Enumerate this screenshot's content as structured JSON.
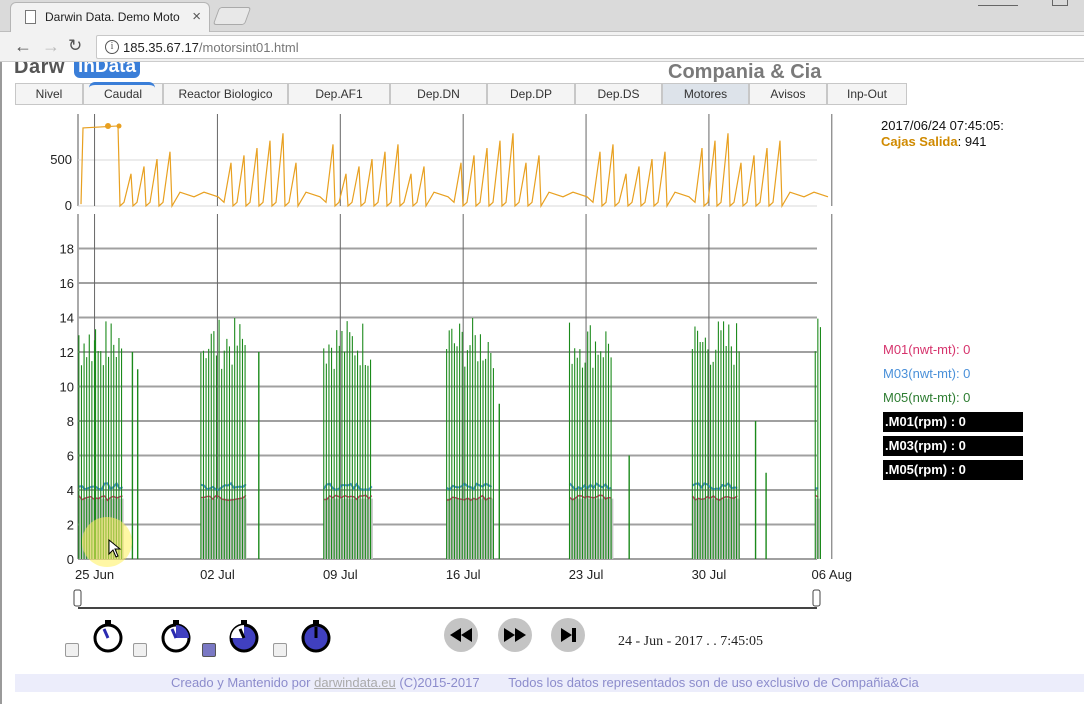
{
  "browser": {
    "tab_title": "Darwin Data. Demo Moto",
    "url_host": "185.35.67.17",
    "url_path": "/motorsint01.html"
  },
  "header": {
    "logo_left": "Darw",
    "logo_badge": "inData",
    "company": "Compania & Cia"
  },
  "menu": [
    {
      "label": "Nivel",
      "active": false
    },
    {
      "label": "Caudal",
      "active": false
    },
    {
      "label": "Reactor Biologico",
      "active": false
    },
    {
      "label": "Dep.AF1",
      "active": false
    },
    {
      "label": "Dep.DN",
      "active": false
    },
    {
      "label": "Dep.DP",
      "active": false
    },
    {
      "label": "Dep.DS",
      "active": false
    },
    {
      "label": "Motores",
      "active": true
    },
    {
      "label": "Avisos",
      "active": false
    },
    {
      "label": "Inp-Out",
      "active": false
    }
  ],
  "readout": {
    "timestamp": "2017/06/24 07:45:05:",
    "cajas_label": "Cajas Salida",
    "cajas_value": ": 941"
  },
  "legend": [
    {
      "text": "M01(nwt-mt): 0",
      "color": "#d6336c"
    },
    {
      "text": "M03(nwt-mt): 0",
      "color": "#4a90d9"
    },
    {
      "text": "M05(nwt-mt): 0",
      "color": "#2e7d32"
    }
  ],
  "legend_boxes": [
    ".M01(rpm) : 0",
    ".M03(rpm) : 0",
    ".M05(rpm) : 0"
  ],
  "playback": {
    "checkbox_states": [
      false,
      false,
      true,
      false
    ],
    "current_date": "24 - Jun - 2017 . . 7:45:05",
    "slider_position": 0
  },
  "footer": {
    "prefix": "Creado y Mantenido por ",
    "link": "darwindata.eu",
    "suffix": " (C)2015-2017        Todos los datos representados son de uso exclusivo de Compañia&Cia"
  },
  "colors": {
    "cajas_line": "#e8a020",
    "m01": "#d6336c",
    "m03": "#4a90d9",
    "m05": "#1b8a1b",
    "area_fill": "#c8c8c8"
  },
  "chart_data": [
    {
      "type": "line",
      "title": "",
      "series": [
        {
          "name": "Cajas Salida",
          "color": "#e8a020"
        }
      ],
      "yticks": [
        0,
        500
      ],
      "x_ticks": [
        "25 Jun",
        "02 Jul",
        "09 Jul",
        "16 Jul",
        "23 Jul",
        "30 Jul",
        "06 Aug"
      ],
      "x_range": [
        "2017-06-24",
        "2017-08-07"
      ],
      "ylim": [
        0,
        1000
      ],
      "grid": true
    },
    {
      "type": "line",
      "title": "",
      "series": [
        {
          "name": "M01(nwt-mt)",
          "color": "#d6336c",
          "typical_active_value": 3.7
        },
        {
          "name": "M03(nwt-mt)",
          "color": "#4a90d9",
          "typical_active_value": 4.0
        },
        {
          "name": "M05(nwt-mt)",
          "color": "#1b8a1b",
          "typical_peak_range": [
            11,
            14
          ]
        }
      ],
      "yticks": [
        0,
        2,
        4,
        6,
        8,
        10,
        12,
        14,
        16,
        18
      ],
      "ylim": [
        0,
        20
      ],
      "x_ticks": [
        "25 Jun",
        "02 Jul",
        "09 Jul",
        "16 Jul",
        "23 Jul",
        "30 Jul",
        "06 Aug"
      ],
      "grid": true
    }
  ]
}
